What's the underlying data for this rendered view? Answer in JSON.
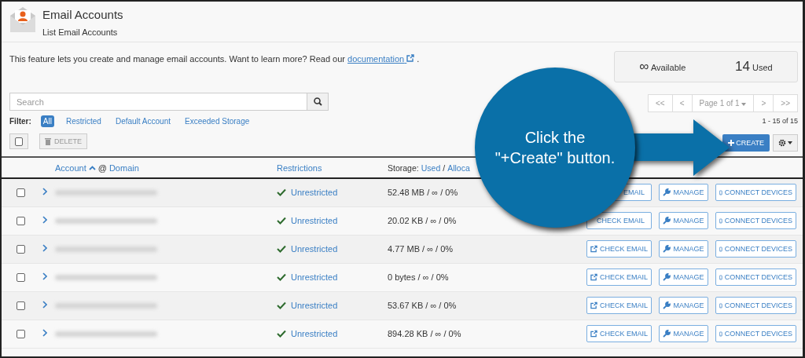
{
  "header": {
    "title": "Email Accounts",
    "subtitle": "List Email Accounts"
  },
  "intro": {
    "text": "This feature lets you create and manage email accounts. Want to learn more? Read our",
    "link": "documentation",
    "end": "."
  },
  "stats": {
    "available_symbol": "∞",
    "available": "Available",
    "used_count": "14",
    "used": "Used"
  },
  "search": {
    "placeholder": "Search"
  },
  "filter": {
    "label": "Filter:",
    "options": [
      {
        "label": "All",
        "selected": true
      },
      {
        "label": "Restricted",
        "selected": false
      },
      {
        "label": "Default Account",
        "selected": false
      },
      {
        "label": "Exceeded Storage",
        "selected": false
      }
    ]
  },
  "toolbar": {
    "select_all_checked": false,
    "delete": "DELETE",
    "delete_disabled": true,
    "create": "CREATE"
  },
  "pagination": {
    "first": "<<",
    "prev": "<",
    "page": "Page 1 of 1",
    "next": ">",
    "last": ">>",
    "range": "1 - 15 of 15"
  },
  "table": {
    "columns": {
      "account": "Account",
      "at": "@",
      "domain": "Domain",
      "restrictions": "Restrictions",
      "storage": "Storage:",
      "used": "Used",
      "sep": "/",
      "allocated": "Alloca"
    },
    "rows": [
      {
        "checked": false,
        "restriction": "Unrestricted",
        "storage": "52.48 MB / ∞ / 0%",
        "check_email": "EMAIL",
        "check_icon": false,
        "manage": "MANAGE",
        "connect": "CONNECT DEVICES"
      },
      {
        "checked": false,
        "restriction": "Unrestricted",
        "storage": "20.02 KB / ∞ / 0%",
        "check_email": "CHECK EMAIL",
        "check_icon": false,
        "manage": "MANAGE",
        "connect": "CONNECT DEVICES"
      },
      {
        "checked": false,
        "restriction": "Unrestricted",
        "storage": "4.77 MB / ∞ / 0%",
        "check_email": "CHECK EMAIL",
        "check_icon": true,
        "manage": "MANAGE",
        "connect": "CONNECT DEVICES"
      },
      {
        "checked": false,
        "restriction": "Unrestricted",
        "storage": "0 bytes / ∞ / 0%",
        "check_email": "CHECK EMAIL",
        "check_icon": true,
        "manage": "MANAGE",
        "connect": "CONNECT DEVICES"
      },
      {
        "checked": false,
        "restriction": "Unrestricted",
        "storage": "53.67 KB / ∞ / 0%",
        "check_email": "CHECK EMAIL",
        "check_icon": true,
        "manage": "MANAGE",
        "connect": "CONNECT DEVICES"
      },
      {
        "checked": false,
        "restriction": "Unrestricted",
        "storage": "894.28 KB / ∞ / 0%",
        "check_email": "CHECK EMAIL",
        "check_icon": true,
        "manage": "MANAGE",
        "connect": "CONNECT DEVICES"
      }
    ]
  },
  "callout": {
    "text": "Click the\n\"+Create\" button."
  }
}
